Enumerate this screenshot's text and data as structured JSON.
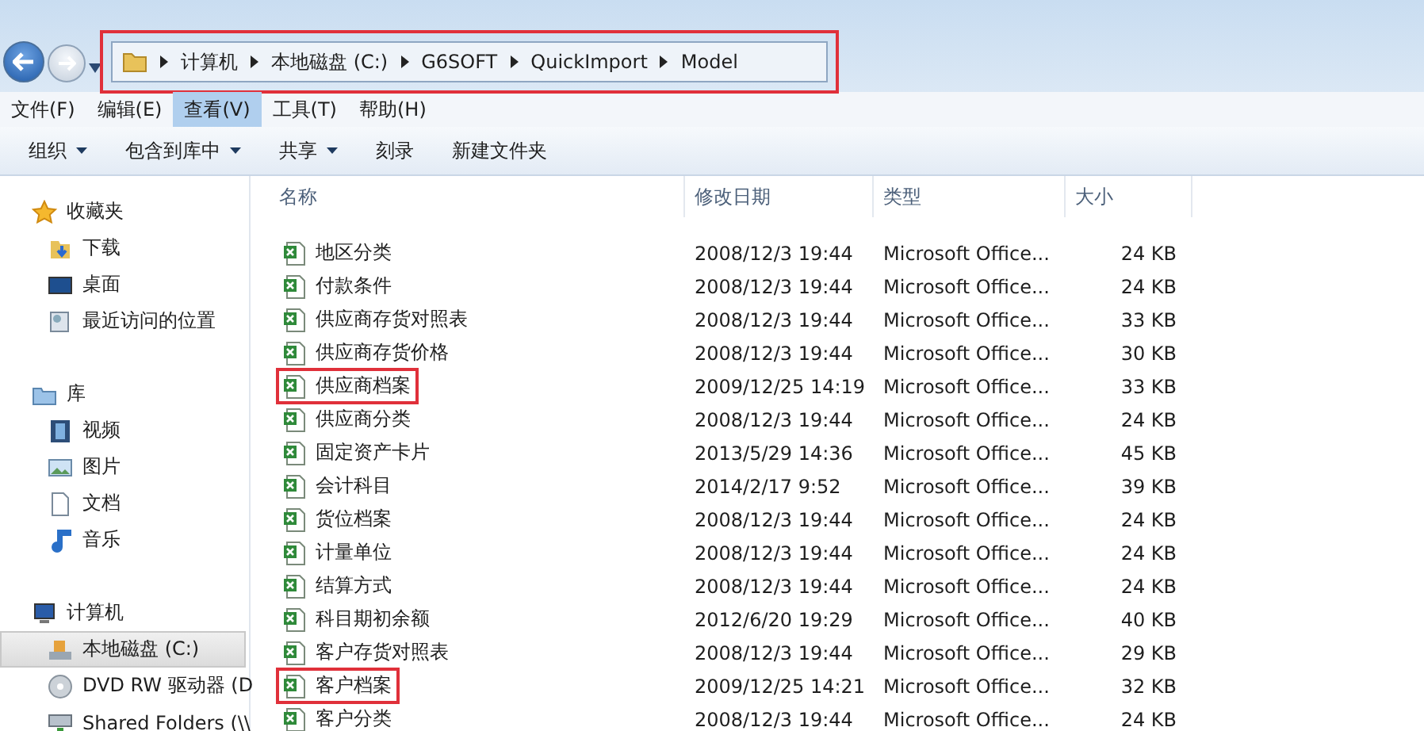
{
  "address_bar": {
    "highlighted": true,
    "path": [
      "计算机",
      "本地磁盘 (C:)",
      "G6SOFT",
      "QuickImport",
      "Model"
    ]
  },
  "menu_bar": [
    {
      "label": "文件(F)",
      "selected": false
    },
    {
      "label": "编辑(E)",
      "selected": false
    },
    {
      "label": "查看(V)",
      "selected": true
    },
    {
      "label": "工具(T)",
      "selected": false
    },
    {
      "label": "帮助(H)",
      "selected": false
    }
  ],
  "toolbar": [
    {
      "label": "组织",
      "dropdown": true
    },
    {
      "label": "包含到库中",
      "dropdown": true
    },
    {
      "label": "共享",
      "dropdown": true
    },
    {
      "label": "刻录",
      "dropdown": false
    },
    {
      "label": "新建文件夹",
      "dropdown": false
    }
  ],
  "sidebar": [
    {
      "label": "收藏夹",
      "kind": "star",
      "selected": false,
      "children": [
        {
          "label": "下载",
          "kind": "download",
          "selected": false
        },
        {
          "label": "桌面",
          "kind": "desktop",
          "selected": false
        },
        {
          "label": "最近访问的位置",
          "kind": "recent",
          "selected": false
        }
      ]
    },
    {
      "label": "库",
      "kind": "library",
      "selected": false,
      "children": [
        {
          "label": "视频",
          "kind": "video",
          "selected": false
        },
        {
          "label": "图片",
          "kind": "picture",
          "selected": false
        },
        {
          "label": "文档",
          "kind": "document",
          "selected": false
        },
        {
          "label": "音乐",
          "kind": "music",
          "selected": false
        }
      ]
    },
    {
      "label": "计算机",
      "kind": "computer",
      "selected": false,
      "children": [
        {
          "label": "本地磁盘 (C:)",
          "kind": "drive",
          "selected": true
        },
        {
          "label": "DVD RW 驱动器 (D",
          "kind": "disc",
          "selected": false
        },
        {
          "label": "Shared Folders (\\\\",
          "kind": "network",
          "selected": false
        }
      ]
    }
  ],
  "file_list": {
    "columns": [
      "名称",
      "修改日期",
      "类型",
      "大小"
    ],
    "rows": [
      {
        "name": "地区分类",
        "date": "2008/12/3 19:44",
        "type": "Microsoft Office...",
        "size": "24 KB",
        "highlighted": false
      },
      {
        "name": "付款条件",
        "date": "2008/12/3 19:44",
        "type": "Microsoft Office...",
        "size": "24 KB",
        "highlighted": false
      },
      {
        "name": "供应商存货对照表",
        "date": "2008/12/3 19:44",
        "type": "Microsoft Office...",
        "size": "33 KB",
        "highlighted": false
      },
      {
        "name": "供应商存货价格",
        "date": "2008/12/3 19:44",
        "type": "Microsoft Office...",
        "size": "30 KB",
        "highlighted": false
      },
      {
        "name": "供应商档案",
        "date": "2009/12/25 14:19",
        "type": "Microsoft Office...",
        "size": "33 KB",
        "highlighted": true
      },
      {
        "name": "供应商分类",
        "date": "2008/12/3 19:44",
        "type": "Microsoft Office...",
        "size": "24 KB",
        "highlighted": false
      },
      {
        "name": "固定资产卡片",
        "date": "2013/5/29 14:36",
        "type": "Microsoft Office...",
        "size": "45 KB",
        "highlighted": false
      },
      {
        "name": "会计科目",
        "date": "2014/2/17 9:52",
        "type": "Microsoft Office...",
        "size": "39 KB",
        "highlighted": false
      },
      {
        "name": "货位档案",
        "date": "2008/12/3 19:44",
        "type": "Microsoft Office...",
        "size": "24 KB",
        "highlighted": false
      },
      {
        "name": "计量单位",
        "date": "2008/12/3 19:44",
        "type": "Microsoft Office...",
        "size": "24 KB",
        "highlighted": false
      },
      {
        "name": "结算方式",
        "date": "2008/12/3 19:44",
        "type": "Microsoft Office...",
        "size": "24 KB",
        "highlighted": false
      },
      {
        "name": "科目期初余额",
        "date": "2012/6/20 19:29",
        "type": "Microsoft Office...",
        "size": "40 KB",
        "highlighted": false
      },
      {
        "name": "客户存货对照表",
        "date": "2008/12/3 19:44",
        "type": "Microsoft Office...",
        "size": "29 KB",
        "highlighted": false
      },
      {
        "name": "客户档案",
        "date": "2009/12/25 14:21",
        "type": "Microsoft Office...",
        "size": "32 KB",
        "highlighted": true
      },
      {
        "name": "客户分类",
        "date": "2008/12/3 19:44",
        "type": "Microsoft Office...",
        "size": "24 KB",
        "highlighted": false
      }
    ]
  }
}
